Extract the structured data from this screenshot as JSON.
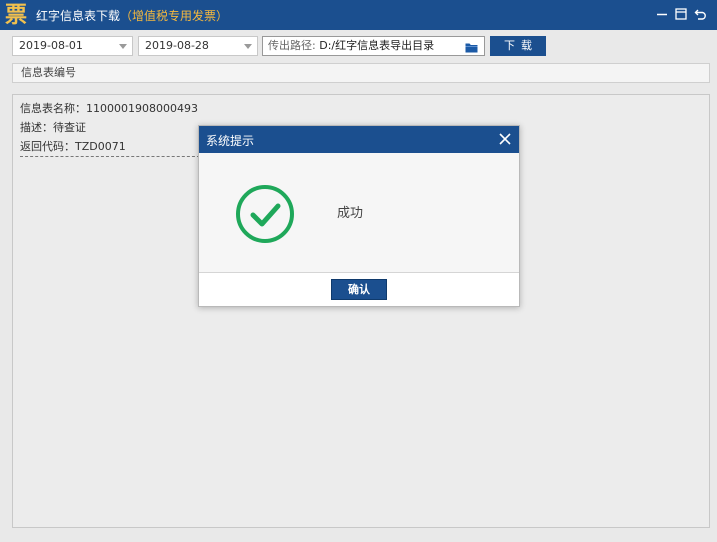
{
  "window": {
    "logo_char": "票",
    "title": "红字信息表下载",
    "title_open": "（",
    "title_sub": "增值税专用发票",
    "title_close": "）"
  },
  "toolbar": {
    "start_date": "2019-08-01",
    "end_date": "2019-08-28",
    "path_label": "传出路径:",
    "path_value": "D:/红字信息表导出目录",
    "download_label": "下载"
  },
  "id_row": {
    "label": "信息表编号"
  },
  "result": {
    "name_line": "信息表名称：1100001908000493",
    "desc_line": "描述：待查证",
    "code_line": "返回代码：TZD0071"
  },
  "dialog": {
    "title": "系统提示",
    "message": "成功",
    "confirm_label": "确认"
  },
  "colors": {
    "accent": "#1b4f8f",
    "subtitle": "#f5b83d",
    "success": "#1fa85a"
  }
}
